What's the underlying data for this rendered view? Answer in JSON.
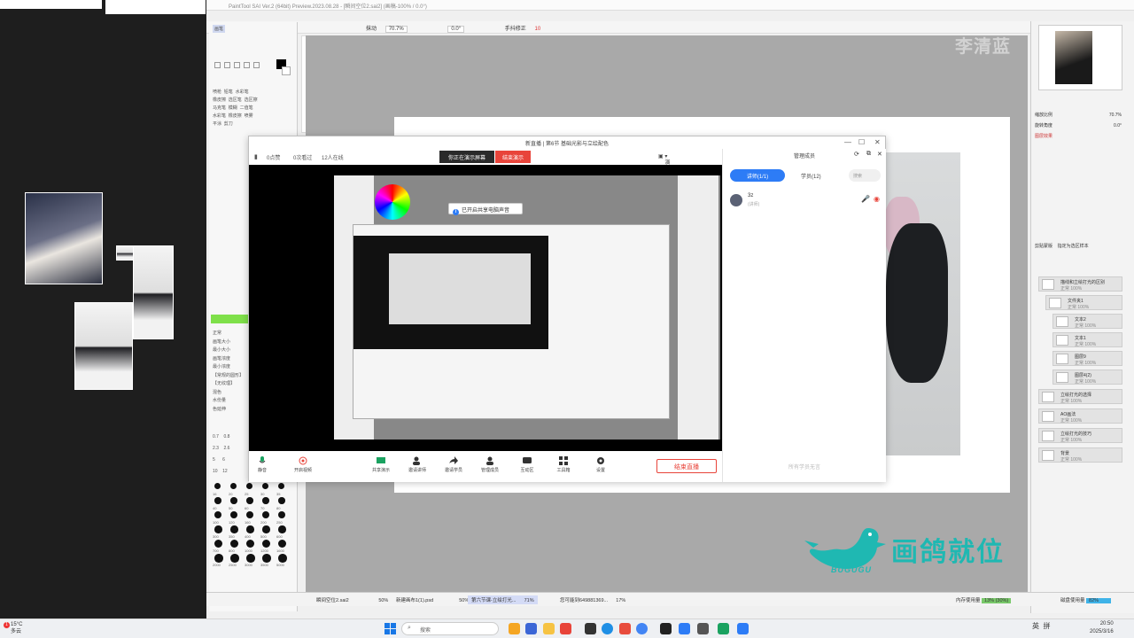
{
  "app": {
    "title_bar": "PaintTool SAI Ver.2 (64bit) Preview.2023.08.28 - [瞬间空位2.sai2] (画稿-100% / 0.0°)",
    "toolbar": {
      "zoom_label": "抹动",
      "zoom": "70.7%",
      "angle": "0.0°",
      "stabilizer_label": "手抖修正",
      "stabilizer_value": "10"
    }
  },
  "tool_panel": {
    "labels": [
      "画笔",
      "喷枪",
      "铅笔",
      "水彩笔",
      "橡皮擦",
      "选区笔",
      "选区擦",
      "马克笔",
      "模糊",
      "二值笔",
      "水彩笔",
      "橡皮擦",
      "喷雾",
      "平涂",
      "剪刀"
    ],
    "settings": [
      "正常",
      "画笔大小",
      "最小大小",
      "画笔浓度",
      "最小浓度",
      "【常规的圆形】",
      "【无纹理】",
      "混色",
      "水份量",
      "色延伸"
    ],
    "brush_sizes_row1": [
      "0.7",
      "0.8"
    ],
    "brush_sizes_row2": [
      "2.3",
      "2.6"
    ],
    "brush_sizes_row3": [
      "5",
      "6"
    ],
    "brush_sizes_row4": [
      "10",
      "12"
    ],
    "brush_sizes_big": [
      "16",
      "20",
      "25",
      "30",
      "35",
      "40",
      "50",
      "60",
      "70",
      "80",
      "100",
      "120",
      "160",
      "200",
      "250",
      "300",
      "350",
      "400",
      "500",
      "600",
      "700",
      "800",
      "1000",
      "1200",
      "1600",
      "2000",
      "2500",
      "3000",
      "3500",
      "5000"
    ]
  },
  "watermark": {
    "name": "李清蓝",
    "brand": "画鸽就位",
    "brand_sub": "BUGUGU"
  },
  "meeting": {
    "title": "新直播 | 第6节 基础光影与立绘配色",
    "info": {
      "likes": "0点赞",
      "watched": "0次看过",
      "online": "12人在线"
    },
    "share_status": "你正在演示屏幕",
    "end_share": "结束演示",
    "speaker_view": "演讲者视图",
    "sound_tip": "已开启共享电脑声音",
    "controls": [
      {
        "label": "静音"
      },
      {
        "label": "开启视频"
      },
      {
        "label": "共享演示"
      },
      {
        "label": "邀请讲师"
      },
      {
        "label": "邀请学员"
      },
      {
        "label": "管理成员"
      },
      {
        "label": "互动区"
      },
      {
        "label": "工具箱"
      },
      {
        "label": "设置"
      }
    ],
    "end_live": "结束直播",
    "members": {
      "title": "管理成员",
      "tab_speaker": "讲师(1/1)",
      "tab_students": "学员(12)",
      "search_placeholder": "搜索",
      "member_name": "3z",
      "member_role": "(讲师)",
      "footer": "所有学员无言"
    }
  },
  "right_panel": {
    "zoom_label": "缩放比例",
    "zoom_value": "70.7%",
    "rotate_label": "旋转角度",
    "rotate_value": "0.0°",
    "layer_effect": "图层效果",
    "layer_mode": "剪贴蒙版",
    "layer_mode2": "指定为选区样本",
    "layers": [
      {
        "name": "描线和立绘打光的区别",
        "mode": "正常",
        "opacity": "100%"
      },
      {
        "name": "文件夹1",
        "mode": "正常",
        "opacity": "100%"
      },
      {
        "name": "文本2",
        "mode": "正常",
        "opacity": "100%"
      },
      {
        "name": "文本1",
        "mode": "正常",
        "opacity": "100%"
      },
      {
        "name": "图层9",
        "mode": "正常",
        "opacity": "100%"
      },
      {
        "name": "图层4(2)",
        "mode": "正常",
        "opacity": "100%"
      },
      {
        "name": "立绘打光的选择",
        "mode": "正常",
        "opacity": "100%"
      },
      {
        "name": "AO画法",
        "mode": "正常",
        "opacity": "100%"
      },
      {
        "name": "立绘打光的技巧",
        "mode": "正常",
        "opacity": "100%"
      },
      {
        "name": "背景",
        "mode": "正常",
        "opacity": "100%"
      }
    ]
  },
  "status_bar": {
    "files": [
      {
        "name": "瞬间空位2.sai2",
        "zoom": "50%"
      },
      {
        "name": "新建画布1(1).psd",
        "zoom": "50%"
      },
      {
        "name": "第六节课-立绘打光...",
        "zoom": "71%"
      },
      {
        "name": "您可能到649881369...",
        "zoom": "17%"
      }
    ],
    "memory_label": "内存使用量",
    "memory_value": "13% (30%)",
    "disk_label": "磁盘使用量",
    "disk_value": "82%"
  },
  "taskbar": {
    "weather_temp": "15°C",
    "weather_desc": "多云",
    "weather_badge": "1",
    "search_placeholder": "搜索",
    "tray_lang": "英",
    "tray_ime": "拼",
    "time": "20:50",
    "date": "2025/3/16"
  },
  "colors": {
    "accent_blue": "#2d7cf6",
    "end_red": "#e8443a",
    "brand_teal": "#1fb8b2"
  }
}
